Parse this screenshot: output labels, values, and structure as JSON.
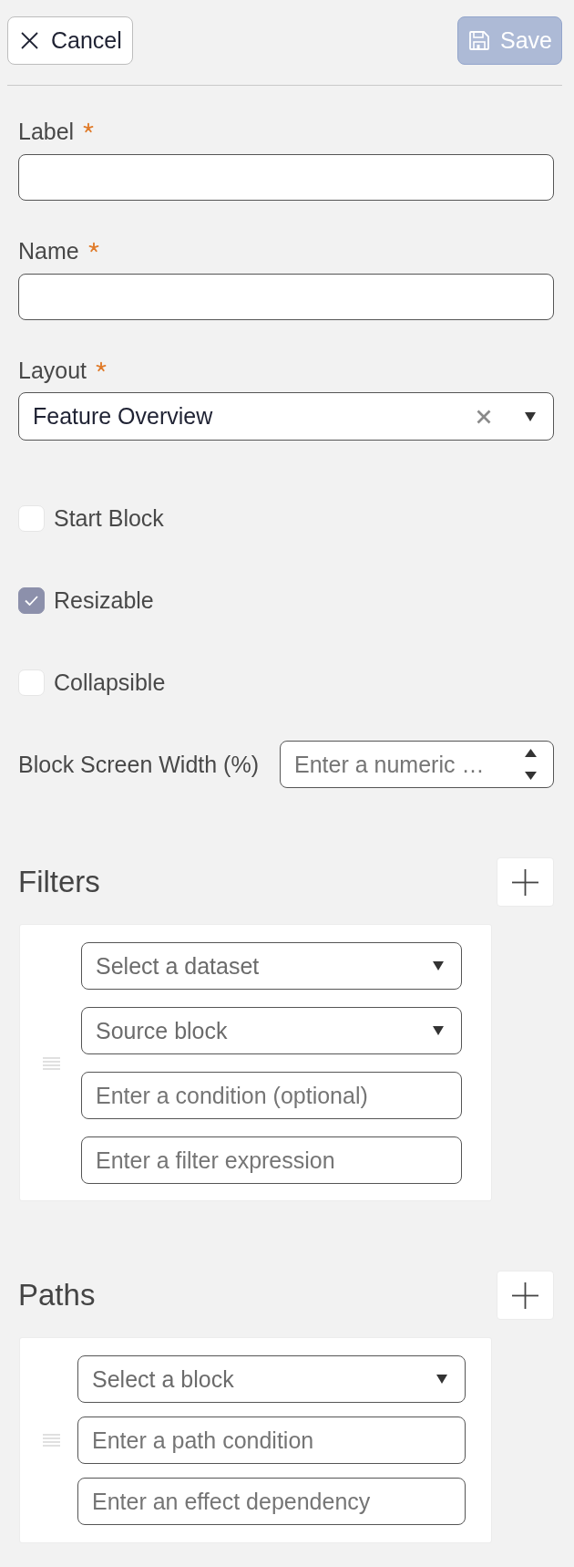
{
  "toolbar": {
    "cancel": {
      "label": "Cancel"
    },
    "save": {
      "label": "Save",
      "disabled": true
    }
  },
  "fields": [
    {
      "kind": "text",
      "label": "Label",
      "required": true
    },
    {
      "kind": "text",
      "label": "Name",
      "required": true
    },
    {
      "kind": "select",
      "label": "Layout",
      "required": true,
      "value": "Feature Overview"
    }
  ],
  "checkboxes": [
    {
      "label": "Start Block",
      "checked": false
    },
    {
      "label": "Resizable",
      "checked": true
    },
    {
      "label": "Collapsible",
      "checked": false
    }
  ],
  "width_field": {
    "label": "Block Screen Width (%)",
    "placeholder": "Enter a numeric …"
  },
  "filters": {
    "title": "Filters",
    "items": [
      {
        "fields": [
          {
            "kind": "select",
            "placeholder": "Select a dataset"
          },
          {
            "kind": "select",
            "placeholder": "Source block"
          },
          {
            "kind": "text",
            "placeholder": "Enter a condition (optional)"
          },
          {
            "kind": "text",
            "placeholder": "Enter a filter expression"
          }
        ]
      }
    ]
  },
  "paths": {
    "title": "Paths",
    "items": [
      {
        "fields": [
          {
            "kind": "select",
            "placeholder": "Select a block"
          },
          {
            "kind": "text",
            "placeholder": "Enter a path condition"
          },
          {
            "kind": "text",
            "placeholder": "Enter an effect dependency"
          }
        ]
      }
    ]
  }
}
